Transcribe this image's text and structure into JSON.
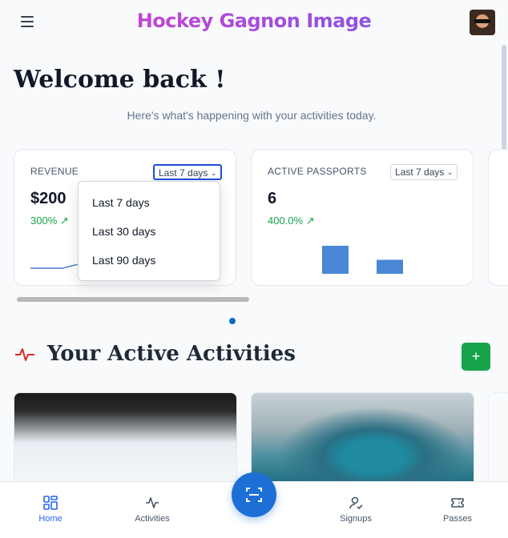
{
  "header": {
    "title": "Hockey Gagnon Image",
    "menu_icon": "hamburger-icon",
    "avatar": "user-avatar"
  },
  "welcome": {
    "heading": "Welcome back !",
    "subtitle": "Here's what's happening with your activities today."
  },
  "stats": [
    {
      "label": "REVENUE",
      "value": "$200",
      "change": "300% ↗",
      "range": "Last 7 days"
    },
    {
      "label": "ACTIVE PASSPORTS",
      "value": "6",
      "change": "400.0% ↗",
      "range": "Last 7 days"
    }
  ],
  "range_dropdown": {
    "options": [
      "Last 7 days",
      "Last 30 days",
      "Last 90 days"
    ]
  },
  "passport_chart": {
    "values": [
      2,
      1
    ]
  },
  "activities": {
    "title": "Your Active Activities",
    "add_label": "+"
  },
  "bottom_nav": {
    "items": [
      {
        "label": "Home",
        "icon": "home-grid-icon",
        "active": true
      },
      {
        "label": "Activities",
        "icon": "activity-icon",
        "active": false
      },
      {
        "label": "Signups",
        "icon": "signup-icon",
        "active": false
      },
      {
        "label": "Passes",
        "icon": "ticket-icon",
        "active": false
      }
    ],
    "fab_icon": "scan-icon"
  },
  "colors": {
    "accent": "#2563eb",
    "success": "#16a34a",
    "fab": "#1d6fd6"
  }
}
